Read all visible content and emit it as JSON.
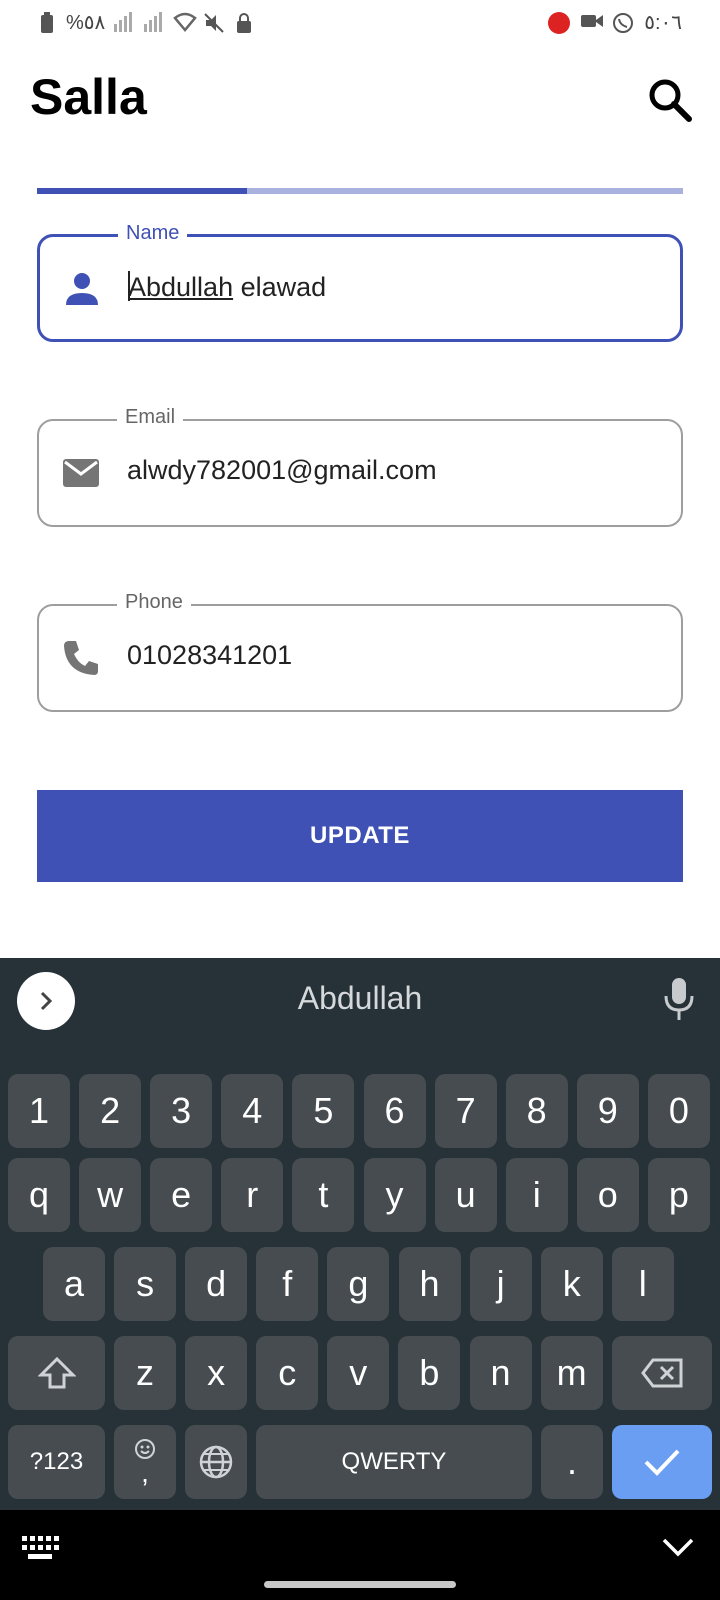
{
  "status_bar": {
    "battery_text": "%٥٨",
    "time": "٥:٠٦"
  },
  "app": {
    "title": "Salla"
  },
  "progress": {
    "fraction": 0.325
  },
  "form": {
    "name": {
      "label": "Name",
      "value_word1": "Abdullah",
      "value_rest": " elawad"
    },
    "email": {
      "label": "Email",
      "value": "alwdy782001@gmail.com"
    },
    "phone": {
      "label": "Phone",
      "value": "01028341201"
    }
  },
  "update_label": "UPDATE",
  "keyboard": {
    "suggestion": "Abdullah",
    "row_numbers": [
      "1",
      "2",
      "3",
      "4",
      "5",
      "6",
      "7",
      "8",
      "9",
      "0"
    ],
    "row_qwerty": [
      "q",
      "w",
      "e",
      "r",
      "t",
      "y",
      "u",
      "i",
      "o",
      "p"
    ],
    "row_asdf": [
      "a",
      "s",
      "d",
      "f",
      "g",
      "h",
      "j",
      "k",
      "l"
    ],
    "row_zxcv": [
      "z",
      "x",
      "c",
      "v",
      "b",
      "n",
      "m"
    ],
    "symbols_label": "?123",
    "comma_label": ",",
    "space_label": "QWERTY",
    "period_label": "."
  },
  "colors": {
    "primary": "#3f51b5",
    "keyboard_bg": "#263238",
    "key_bg": "#464c50",
    "enter_key": "#6a9ef3"
  }
}
